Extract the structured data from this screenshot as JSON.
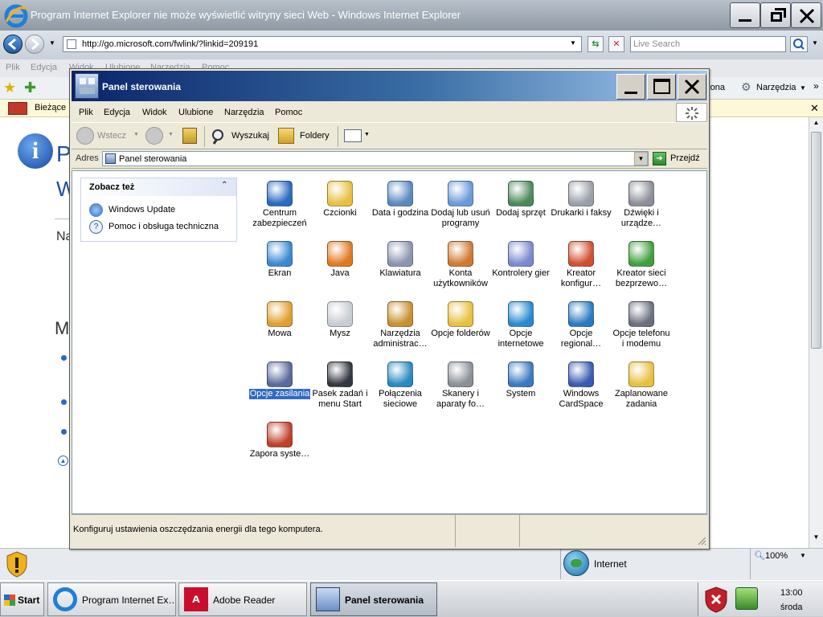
{
  "ie": {
    "title": "Program Internet Explorer nie może wyświetlić witryny sieci Web - Windows Internet Explorer",
    "url": "http://go.microsoft.com/fwlink/?linkid=209191",
    "search_placeholder": "Live Search",
    "menu": [
      "Plik",
      "Edycja",
      "Widok",
      "Ulubione",
      "Narzędzia",
      "Pomoc"
    ],
    "fav_right": [
      "rona",
      "Narzędzia"
    ],
    "info_tab": "Bieżące",
    "status_zone": "Internet",
    "zoom": "100%",
    "page_fragments": [
      "P",
      "W",
      "Na",
      "M"
    ]
  },
  "explorer": {
    "title": "Panel sterowania",
    "menu": [
      "Plik",
      "Edycja",
      "Widok",
      "Ulubione",
      "Narzędzia",
      "Pomoc"
    ],
    "toolbar": {
      "back": "Wstecz",
      "search": "Wyszukaj",
      "folders": "Foldery"
    },
    "address_label": "Adres",
    "address_value": "Panel sterowania",
    "go_label": "Przejdź",
    "side_panel": {
      "title": "Zobacz też",
      "items": [
        "Windows Update",
        "Pomoc i obsługa techniczna"
      ]
    },
    "items": [
      {
        "label": "Centrum zabezpieczeń",
        "icon": "shield-icon"
      },
      {
        "label": "Czcionki",
        "icon": "fonts-folder-icon"
      },
      {
        "label": "Data i godzina",
        "icon": "calendar-clock-icon"
      },
      {
        "label": "Dodaj lub usuń programy",
        "icon": "cd-box-icon"
      },
      {
        "label": "Dodaj sprzęt",
        "icon": "hardware-icon"
      },
      {
        "label": "Drukarki i faksy",
        "icon": "printer-icon"
      },
      {
        "label": "Dźwięki i urządze…",
        "icon": "speaker-icon"
      },
      {
        "label": "Ekran",
        "icon": "display-icon"
      },
      {
        "label": "Java",
        "icon": "java-cup-icon"
      },
      {
        "label": "Klawiatura",
        "icon": "keyboard-icon"
      },
      {
        "label": "Konta użytkowników",
        "icon": "users-icon"
      },
      {
        "label": "Kontrolery gier",
        "icon": "gamepad-icon"
      },
      {
        "label": "Kreator konfigur…",
        "icon": "house-icon"
      },
      {
        "label": "Kreator sieci bezprzewo…",
        "icon": "wireless-icon"
      },
      {
        "label": "Mowa",
        "icon": "speech-icon"
      },
      {
        "label": "Mysz",
        "icon": "mouse-icon"
      },
      {
        "label": "Narzędzia administrac…",
        "icon": "admin-tools-icon"
      },
      {
        "label": "Opcje folderów",
        "icon": "folder-options-icon"
      },
      {
        "label": "Opcje internetowe",
        "icon": "internet-options-icon"
      },
      {
        "label": "Opcje regional…",
        "icon": "globe-icon"
      },
      {
        "label": "Opcje telefonu i modemu",
        "icon": "phone-icon"
      },
      {
        "label": "Opcje zasilania",
        "icon": "power-icon"
      },
      {
        "label": "Pasek zadań i menu Start",
        "icon": "taskbar-icon"
      },
      {
        "label": "Połączenia sieciowe",
        "icon": "network-icon"
      },
      {
        "label": "Skanery i aparaty fo…",
        "icon": "scanner-icon"
      },
      {
        "label": "System",
        "icon": "system-icon"
      },
      {
        "label": "Windows CardSpace",
        "icon": "cardspace-icon"
      },
      {
        "label": "Zaplanowane zadania",
        "icon": "scheduled-tasks-icon"
      },
      {
        "label": "Zapora syste…",
        "icon": "firewall-icon"
      }
    ],
    "selected_item": "Opcje zasilania",
    "status_text": "Konfiguruj ustawienia oszczędzania energii dla tego komputera."
  },
  "taskbar": {
    "start": "Start",
    "buttons": [
      "Program Internet Ex…",
      "Adobe Reader",
      "Panel sterowania"
    ],
    "time": "13:00",
    "day": "środa"
  },
  "colors": {
    "title_blue": "#0a246a",
    "selection": "#316ac5",
    "xp_face": "#ece9d8"
  }
}
